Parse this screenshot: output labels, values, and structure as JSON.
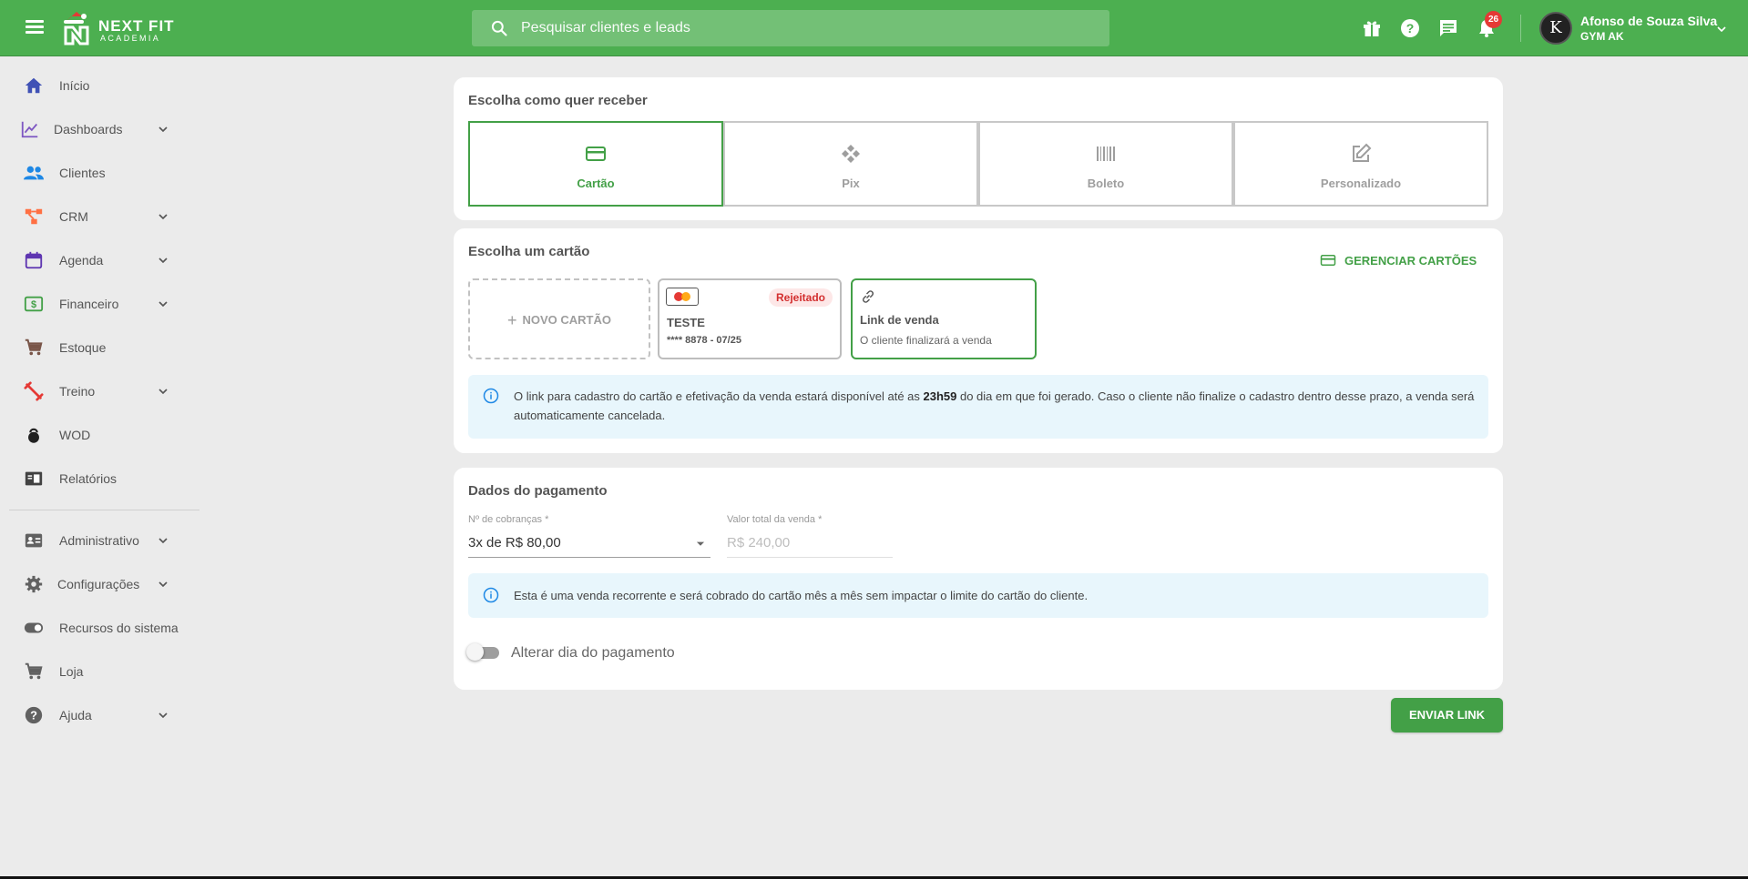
{
  "app": {
    "brand": "NEXT FIT",
    "brand_sub": "ACADEMIA"
  },
  "header": {
    "search_placeholder": "Pesquisar clientes e leads",
    "notification_count": "26",
    "user_name": "Afonso de Souza Silva",
    "user_gym": "GYM AK",
    "avatar_letter": "K"
  },
  "sidebar": {
    "items": [
      {
        "label": "Início",
        "icon": "home-icon",
        "color": "#3f51b5"
      },
      {
        "label": "Dashboards",
        "icon": "chart-line-icon",
        "color": "#7e57c2",
        "expandable": true
      },
      {
        "label": "Clientes",
        "icon": "people-icon",
        "color": "#1e88e5"
      },
      {
        "label": "CRM",
        "icon": "crm-icon",
        "color": "#ff7043",
        "expandable": true
      },
      {
        "label": "Agenda",
        "icon": "calendar-icon",
        "color": "#5e35b1",
        "expandable": true
      },
      {
        "label": "Financeiro",
        "icon": "money-icon",
        "color": "#43a047",
        "expandable": true
      },
      {
        "label": "Estoque",
        "icon": "cart-icon",
        "color": "#795548"
      },
      {
        "label": "Treino",
        "icon": "dumbbell-icon",
        "color": "#e53935",
        "expandable": true
      },
      {
        "label": "WOD",
        "icon": "kettlebell-icon",
        "color": "#212121"
      },
      {
        "label": "Relatórios",
        "icon": "report-icon",
        "color": "#424242"
      },
      {
        "label": "Administrativo",
        "icon": "id-card-icon",
        "color": "#616161",
        "expandable": true
      },
      {
        "label": "Configurações",
        "icon": "gear-icon",
        "color": "#616161",
        "expandable": true
      },
      {
        "label": "Recursos do sistema",
        "icon": "toggle-icon",
        "color": "#616161"
      },
      {
        "label": "Loja",
        "icon": "cart-icon",
        "color": "#616161"
      },
      {
        "label": "Ajuda",
        "icon": "help-icon",
        "color": "#616161",
        "expandable": true
      }
    ]
  },
  "receive": {
    "title": "Escolha como quer receber",
    "methods": [
      {
        "label": "Cartão",
        "icon": "credit-card-icon",
        "active": true
      },
      {
        "label": "Pix",
        "icon": "pix-icon",
        "active": false
      },
      {
        "label": "Boleto",
        "icon": "barcode-icon",
        "active": false
      },
      {
        "label": "Personalizado",
        "icon": "edit-icon",
        "active": false
      }
    ]
  },
  "card_choice": {
    "title": "Escolha um cartão",
    "manage_label": "GERENCIAR CARTÕES",
    "new_card_label": "NOVO CARTÃO",
    "saved_card": {
      "name": "TESTE",
      "number": "**** 8878 - 07/25",
      "status": "Rejeitado"
    },
    "link_card": {
      "title": "Link de venda",
      "subtitle": "O cliente finalizará a venda"
    },
    "info_before": "O link para cadastro do cartão e efetivação da venda estará disponível até as ",
    "info_bold": "23h59",
    "info_after": " do dia em que foi gerado. Caso o cliente não finalize o cadastro dentro desse prazo, a venda será automaticamente cancelada."
  },
  "payment": {
    "title": "Dados do pagamento",
    "charges_label": "Nº de cobranças *",
    "charges_value": "3x de R$ 80,00",
    "total_label": "Valor total da venda *",
    "total_value": "R$ 240,00",
    "info": "Esta é uma venda recorrente e será cobrado do cartão mês a mês sem impactar o limite do cartão do cliente.",
    "toggle_label": "Alterar dia do pagamento",
    "toggle_on": false
  },
  "actions": {
    "send_label": "ENVIAR LINK"
  },
  "colors": {
    "brand_green": "#4caf50",
    "accent_green": "#43a047",
    "info_bg": "#e8f6fc",
    "reject_red": "#d32f2f"
  }
}
